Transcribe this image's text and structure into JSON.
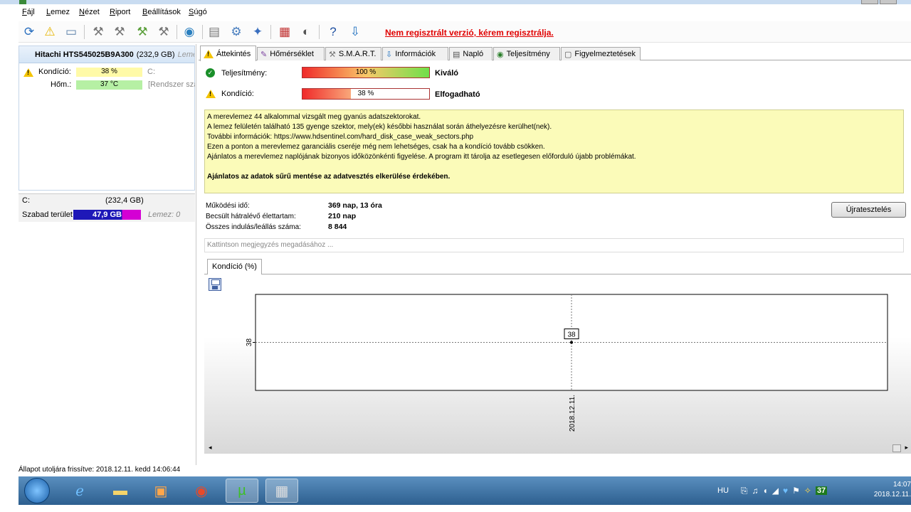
{
  "menu": [
    "Fájl",
    "Lemez",
    "Nézet",
    "Riport",
    "Beállítások",
    "Súgó"
  ],
  "toolbar": {
    "register_link": "Nem regisztrált verzió, kérem regisztrálja.",
    "icons": [
      "refresh-icon",
      "alert-icon",
      "disk-icon",
      "tool-icon-1",
      "tool-icon-2",
      "tool-icon-3",
      "tool-icon-4",
      "globe-icon",
      "report-icon",
      "network-icon",
      "settings-icon",
      "chart-icon",
      "disk-activity-icon",
      "help-icon",
      "download-icon"
    ]
  },
  "disk": {
    "name": "Hitachi HTS545025B9A300",
    "size": "(232,9 GB)",
    "lemez_label": "Lemez",
    "condition_label": "Kondíció:",
    "condition_value": "38 %",
    "condition_drive": "C:",
    "temp_label": "Hőm.:",
    "temp_value": "37 °C",
    "temp_note": "[Rendszer szá"
  },
  "volume": {
    "letter": "C:",
    "size": "(232,4 GB)",
    "free_label": "Szabad terület",
    "free_value": "47,9 GB",
    "free_fraction": 0.72,
    "lemez": "Lemez: 0"
  },
  "status_text": "Állapot utoljára frissítve: 2018.12.11. kedd 14:06:44",
  "tabs": [
    {
      "label": "Áttekintés",
      "icon": "warning-icon"
    },
    {
      "label": "Hőmérséklet",
      "icon": "thermometer-icon"
    },
    {
      "label": "S.M.A.R.T.",
      "icon": "smart-icon"
    },
    {
      "label": "Információk",
      "icon": "info-icon"
    },
    {
      "label": "Napló",
      "icon": "log-icon"
    },
    {
      "label": "Teljesítmény",
      "icon": "performance-icon"
    },
    {
      "label": "Figyelmeztetések",
      "icon": "notice-icon"
    }
  ],
  "performance": {
    "label": "Teljesítmény:",
    "percent": "100 %",
    "fraction": 1.0,
    "rating": "Kiváló"
  },
  "condition": {
    "label": "Kondíció:",
    "percent": "38 %",
    "fraction": 0.38,
    "rating": "Elfogadható"
  },
  "info_lines": [
    "A merevlemez 44 alkalommal vizsgált meg gyanús adatszektorokat.",
    "A lemez felületén található 135 gyenge szektor, mely(ek) későbbi használat során áthelyezésre kerülhet(nek).",
    "További információk: https://www.hdsentinel.com/hard_disk_case_weak_sectors.php",
    "Ezen a ponton a merevlemez garanciális cseréje még nem lehetséges, csak ha a kondíció tovább csökken.",
    "Ajánlatos a merevlemez naplójának bizonyos időközönkénti figyelése. A program itt tárolja az esetlegesen előforduló újabb problémákat."
  ],
  "info_bold": "Ajánlatos az adatok sűrű mentése az adatvesztés elkerülése érdekében.",
  "stats": [
    {
      "label": "Működési idő:",
      "value": "369 nap, 13 óra"
    },
    {
      "label": "Becsült hátralévő élettartam:",
      "value": "210 nap"
    },
    {
      "label": "Összes indulás/leállás száma:",
      "value": "8 844"
    }
  ],
  "retest_button": "Újratesztelés",
  "note_placeholder": "Kattintson megjegyzés megadásához ...",
  "chart_tab": "Kondíció  (%)",
  "chart_data": {
    "type": "line",
    "x": [
      "2018.12.11."
    ],
    "series": [
      {
        "values": [
          38
        ]
      }
    ],
    "title": "",
    "xlabel": "",
    "ylabel": "",
    "y_ticks": [
      "38"
    ],
    "data_labels": [
      "38"
    ],
    "grid": true
  },
  "taskbar": {
    "apps": [
      "windows-start",
      "internet-explorer",
      "file-explorer",
      "media-player",
      "chrome",
      "utorrent",
      "hd-sentinel"
    ],
    "lang": "HU",
    "tray_badge": "37",
    "time": "14:07",
    "date": "2018.12.11."
  }
}
